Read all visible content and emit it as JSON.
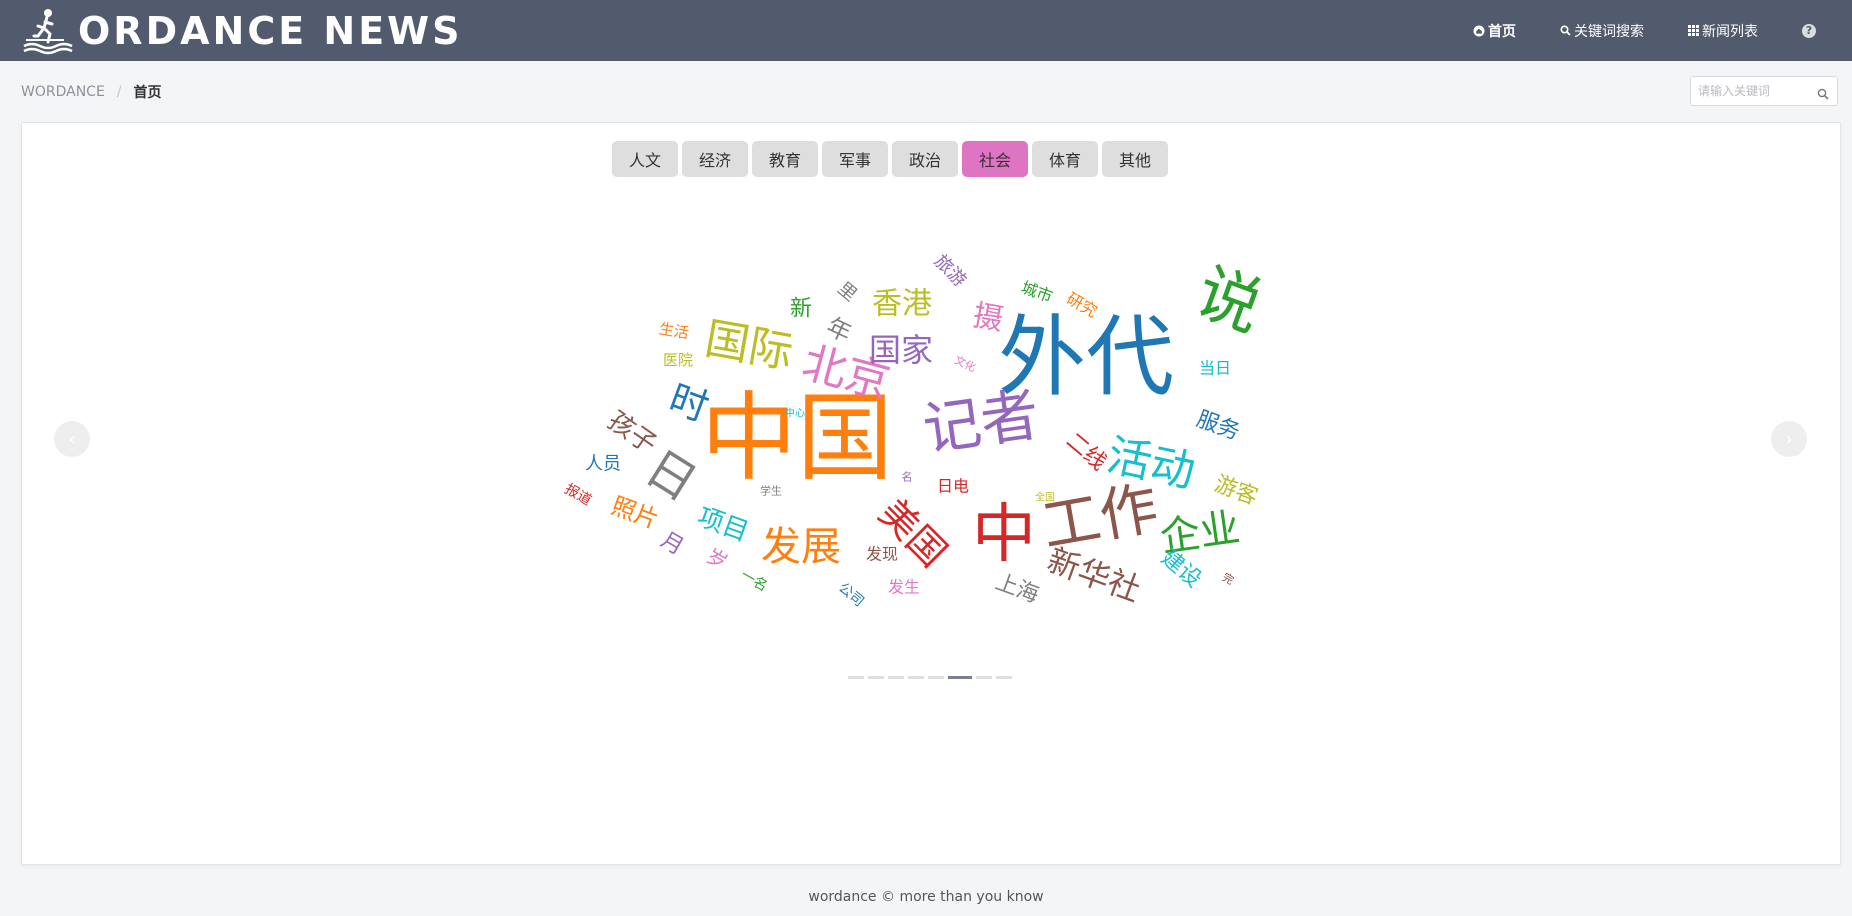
{
  "header": {
    "logo_text": "ORDANCE NEWS",
    "nav": [
      {
        "label": "首页",
        "icon": "home-icon"
      },
      {
        "label": "关键词搜索",
        "icon": "search-icon"
      },
      {
        "label": "新闻列表",
        "icon": "grid-icon"
      }
    ],
    "help_symbol": "?"
  },
  "breadcrumb": {
    "root": "WORDANCE",
    "separator": "/",
    "current": "首页"
  },
  "search": {
    "placeholder": "请输入关键词"
  },
  "tabs": [
    "人文",
    "经济",
    "教育",
    "军事",
    "政治",
    "社会",
    "体育",
    "其他"
  ],
  "active_tab": 5,
  "carousel": {
    "prev": "‹",
    "next": "›",
    "slide_count": 8,
    "active_slide": 5
  },
  "wordcloud": [
    {
      "text": "外代",
      "color": "#1f77b4",
      "rot": 0
    },
    {
      "text": "中国",
      "color": "#ff7f0e",
      "rot": 0
    },
    {
      "text": "说",
      "color": "#2ca02c",
      "rot": 0
    },
    {
      "text": "记者",
      "color": "#9467bd",
      "rot": 0
    },
    {
      "text": "中",
      "color": "#d62728",
      "rot": 0
    },
    {
      "text": "工作",
      "color": "#8c564b",
      "rot": 0
    },
    {
      "text": "北京",
      "color": "#e377c2",
      "rot": 0
    },
    {
      "text": "活动",
      "color": "#17becf",
      "rot": 0
    },
    {
      "text": "发展",
      "color": "#ff7f0e",
      "rot": 0
    },
    {
      "text": "国际",
      "color": "#bcbd22",
      "rot": 0
    },
    {
      "text": "日",
      "color": "#7f7f7f",
      "rot": 0
    },
    {
      "text": "企业",
      "color": "#2ca02c",
      "rot": 0
    },
    {
      "text": "新华社",
      "color": "#8c564b",
      "rot": 0
    },
    {
      "text": "美国",
      "color": "#d62728",
      "rot": 0
    },
    {
      "text": "国家",
      "color": "#9467bd",
      "rot": 0
    },
    {
      "text": "时",
      "color": "#1f77b4",
      "rot": 0
    },
    {
      "text": "香港",
      "color": "#bcbd22",
      "rot": 0
    },
    {
      "text": "项目",
      "color": "#17becf",
      "rot": 0
    },
    {
      "text": "照片",
      "color": "#ff7f0e",
      "rot": 0
    },
    {
      "text": "孩子",
      "color": "#8c564b",
      "rot": 0
    },
    {
      "text": "摄",
      "color": "#e377c2",
      "rot": 0
    },
    {
      "text": "服务",
      "color": "#1f77b4",
      "rot": 0
    },
    {
      "text": "年",
      "color": "#7f7f7f",
      "rot": 0
    },
    {
      "text": "上海",
      "color": "#7f7f7f",
      "rot": 0
    },
    {
      "text": "二线",
      "color": "#d62728",
      "rot": 0
    },
    {
      "text": "游客",
      "color": "#bcbd22",
      "rot": 0
    },
    {
      "text": "建设",
      "color": "#17becf",
      "rot": 0
    },
    {
      "text": "新",
      "color": "#2ca02c",
      "rot": 0
    },
    {
      "text": "月",
      "color": "#9467bd",
      "rot": 0
    },
    {
      "text": "岁",
      "color": "#e377c2",
      "rot": 0
    },
    {
      "text": "人员",
      "color": "#1f77b4",
      "rot": 0
    },
    {
      "text": "发生",
      "color": "#e377c2",
      "rot": 0
    },
    {
      "text": "发现",
      "color": "#8c564b",
      "rot": 0
    },
    {
      "text": "日电",
      "color": "#d62728",
      "rot": 0
    },
    {
      "text": "旅游",
      "color": "#9467bd",
      "rot": 0
    },
    {
      "text": "城市",
      "color": "#2ca02c",
      "rot": 0
    },
    {
      "text": "研究",
      "color": "#ff7f0e",
      "rot": 0
    },
    {
      "text": "当日",
      "color": "#17becf",
      "rot": 0
    },
    {
      "text": "生活",
      "color": "#ff7f0e",
      "rot": 0
    },
    {
      "text": "医院",
      "color": "#bcbd22",
      "rot": 0
    },
    {
      "text": "里",
      "color": "#7f7f7f",
      "rot": 0
    },
    {
      "text": "报道",
      "color": "#d62728",
      "rot": 0
    },
    {
      "text": "公司",
      "color": "#1f77b4",
      "rot": 0
    },
    {
      "text": "一名",
      "color": "#2ca02c",
      "rot": 0
    },
    {
      "text": "学生",
      "color": "#7f7f7f",
      "rot": 0
    },
    {
      "text": "名",
      "color": "#9467bd",
      "rot": 0
    },
    {
      "text": "文化",
      "color": "#e377c2",
      "rot": 0
    },
    {
      "text": "中心",
      "color": "#17becf",
      "rot": 0
    },
    {
      "text": "全国",
      "color": "#bcbd22",
      "rot": 0
    },
    {
      "text": "完",
      "color": "#8c564b",
      "rot": 0
    }
  ],
  "footer": "wordance © more than you know"
}
